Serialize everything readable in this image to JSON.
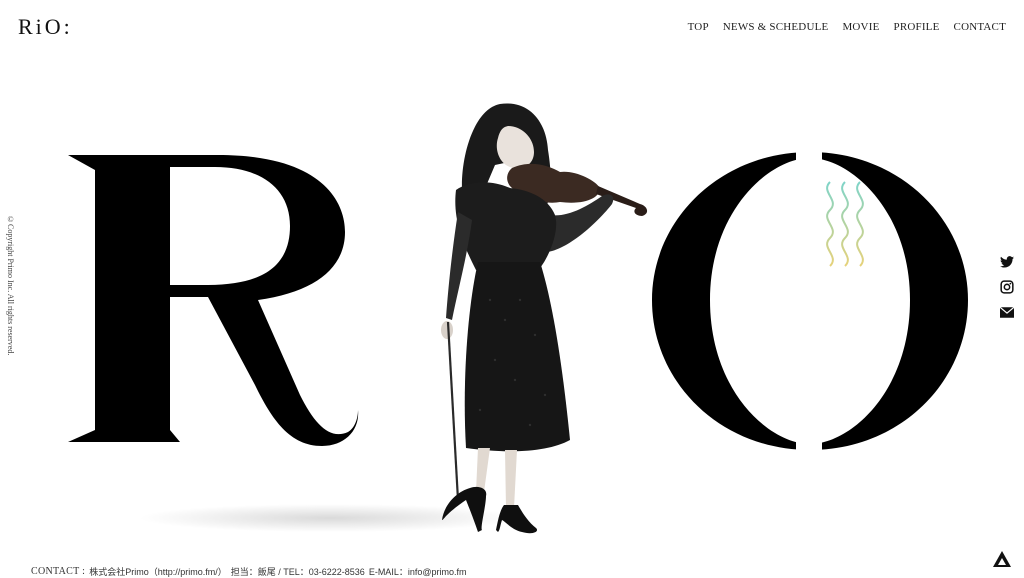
{
  "header": {
    "logo": "RiO:",
    "nav": [
      "TOP",
      "NEWS & SCHEDULE",
      "MOVIE",
      "PROFILE",
      "CONTACT"
    ]
  },
  "sidebar": {
    "copyright": "©Copyright Primo Inc. All rights reserved."
  },
  "hero": {
    "letter_r": "R",
    "letter_o": "O"
  },
  "social": {
    "icons": [
      "twitter-icon",
      "instagram-icon",
      "mail-icon"
    ]
  },
  "footer": {
    "contact_label": "CONTACT :",
    "company": "株式会社Primo（http://primo.fm/）",
    "person": "担当：飯尾 / TEL：03-6222-8536",
    "email": "E-MAIL：info@primo.fm"
  },
  "colors": {
    "text": "#111111",
    "background": "#ffffff",
    "wave_top": "#7fd4c8",
    "wave_bottom": "#e6d27a"
  }
}
